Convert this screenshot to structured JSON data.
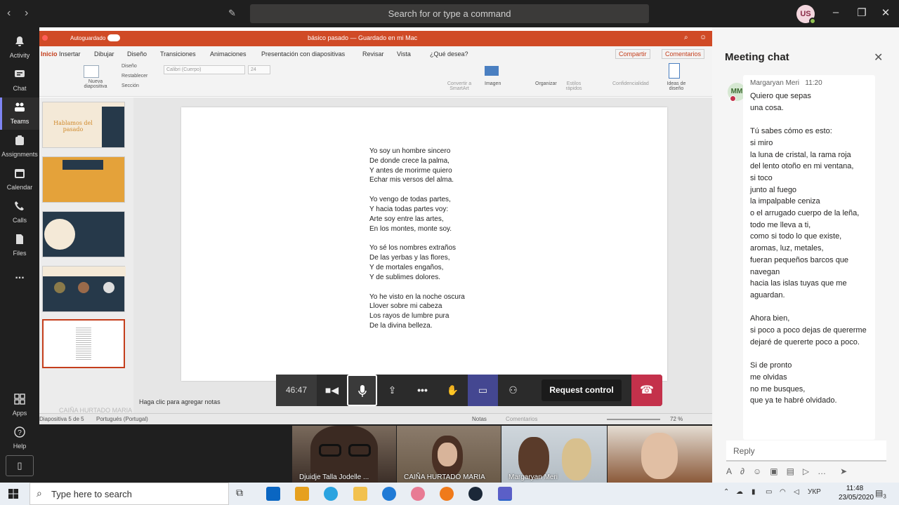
{
  "titlebar": {
    "search_placeholder": "Search for or type a command",
    "user_initials": "US"
  },
  "rail": [
    {
      "label": "Activity",
      "icon": "bell-icon"
    },
    {
      "label": "Chat",
      "icon": "chat-icon"
    },
    {
      "label": "Teams",
      "icon": "teams-icon"
    },
    {
      "label": "Assignments",
      "icon": "assignments-icon"
    },
    {
      "label": "Calendar",
      "icon": "calendar-icon"
    },
    {
      "label": "Calls",
      "icon": "phone-icon"
    },
    {
      "label": "Files",
      "icon": "files-icon"
    },
    {
      "label": "...",
      "icon": "more-icon"
    },
    {
      "label": "Apps",
      "icon": "apps-icon"
    },
    {
      "label": "Help",
      "icon": "help-icon"
    }
  ],
  "powerpoint": {
    "autosave": "Autoguardado",
    "doc_title": "básico pasado — Guardado en mi Mac",
    "tabs": [
      "Inicio",
      "Insertar",
      "Dibujar",
      "Diseño",
      "Transiciones",
      "Animaciones",
      "Presentación con diapositivas",
      "Revisar",
      "Vista",
      "¿Qué desea?"
    ],
    "share_label": "Compartir",
    "comments_label": "Comentarios",
    "ribbon": {
      "new_slide": "Nueva diapositiva",
      "design": "Diseño",
      "reset": "Restablecer",
      "section": "Sección",
      "font": "Calibri (Cuerpo)",
      "size": "24",
      "image": "Imagen",
      "organize": "Organizar",
      "styles": "Estilos rápidos",
      "confidentiality": "Confidencialidad",
      "design_ideas": "Ideas de diseño",
      "smartart": "Convertir a SmartArt"
    },
    "thumb1_title": "Hablamos del pasado",
    "poem": [
      [
        "Yo soy un hombre sincero",
        "De donde crece la palma,",
        "Y antes de morirme quiero",
        "Echar mis versos del alma."
      ],
      [
        "Yo vengo de todas partes,",
        "Y hacia todas partes voy:",
        "Arte soy entre las artes,",
        "En los montes, monte soy."
      ],
      [
        "Yo sé los nombres extraños",
        "De las yerbas y las flores,",
        "Y de mortales engaños,",
        "Y de sublimes dolores."
      ],
      [
        "Yo he visto en la noche oscura",
        "Llover sobre mi cabeza",
        "Los rayos de lumbre pura",
        "De la divina belleza."
      ]
    ],
    "notes_placeholder": "Haga clic para agregar notas",
    "presenter_watermark": "CAIÑA HURTADO MARIA",
    "status": {
      "slide": "Diapositiva 5 de 5",
      "language": "Portugués (Portugal)",
      "notes": "Notas",
      "comments": "Comentarios",
      "zoom": "72 %"
    }
  },
  "call": {
    "timer": "46:47",
    "request_control": "Request control"
  },
  "chat": {
    "title": "Meeting chat",
    "sender": "Margaryan Meri",
    "sender_initials": "MM",
    "time": "11:20",
    "message": "Quiero que sepas\nuna cosa.\n\nTú sabes cómo es esto:\nsi miro\nla luna de cristal, la rama roja\ndel lento otoño en mi ventana,\nsi toco\njunto al fuego\nla impalpable ceniza\no el arrugado cuerpo de la leña,\ntodo me lleva a ti,\ncomo si todo lo que existe,\naromas, luz, metales,\nfueran pequeños barcos que navegan\nhacia las islas tuyas que me aguardan.\n\nAhora bien,\nsi poco a poco dejas de quererme\ndejaré de quererte poco a poco.\n\nSi de pronto\nme olvidas\nno me busques,\nque ya te habré olvidado.",
    "reply_placeholder": "Reply"
  },
  "participants": [
    {
      "name": "Djuidje Talla Jodelle ..."
    },
    {
      "name": "CAIÑA HURTADO MARIA"
    },
    {
      "name": "Margaryan Meri"
    },
    {
      "name": ""
    }
  ],
  "taskbar": {
    "search_placeholder": "Type here to search",
    "language": "УКР",
    "time": "11:48",
    "date": "23/05/2020",
    "notifications": "3"
  }
}
